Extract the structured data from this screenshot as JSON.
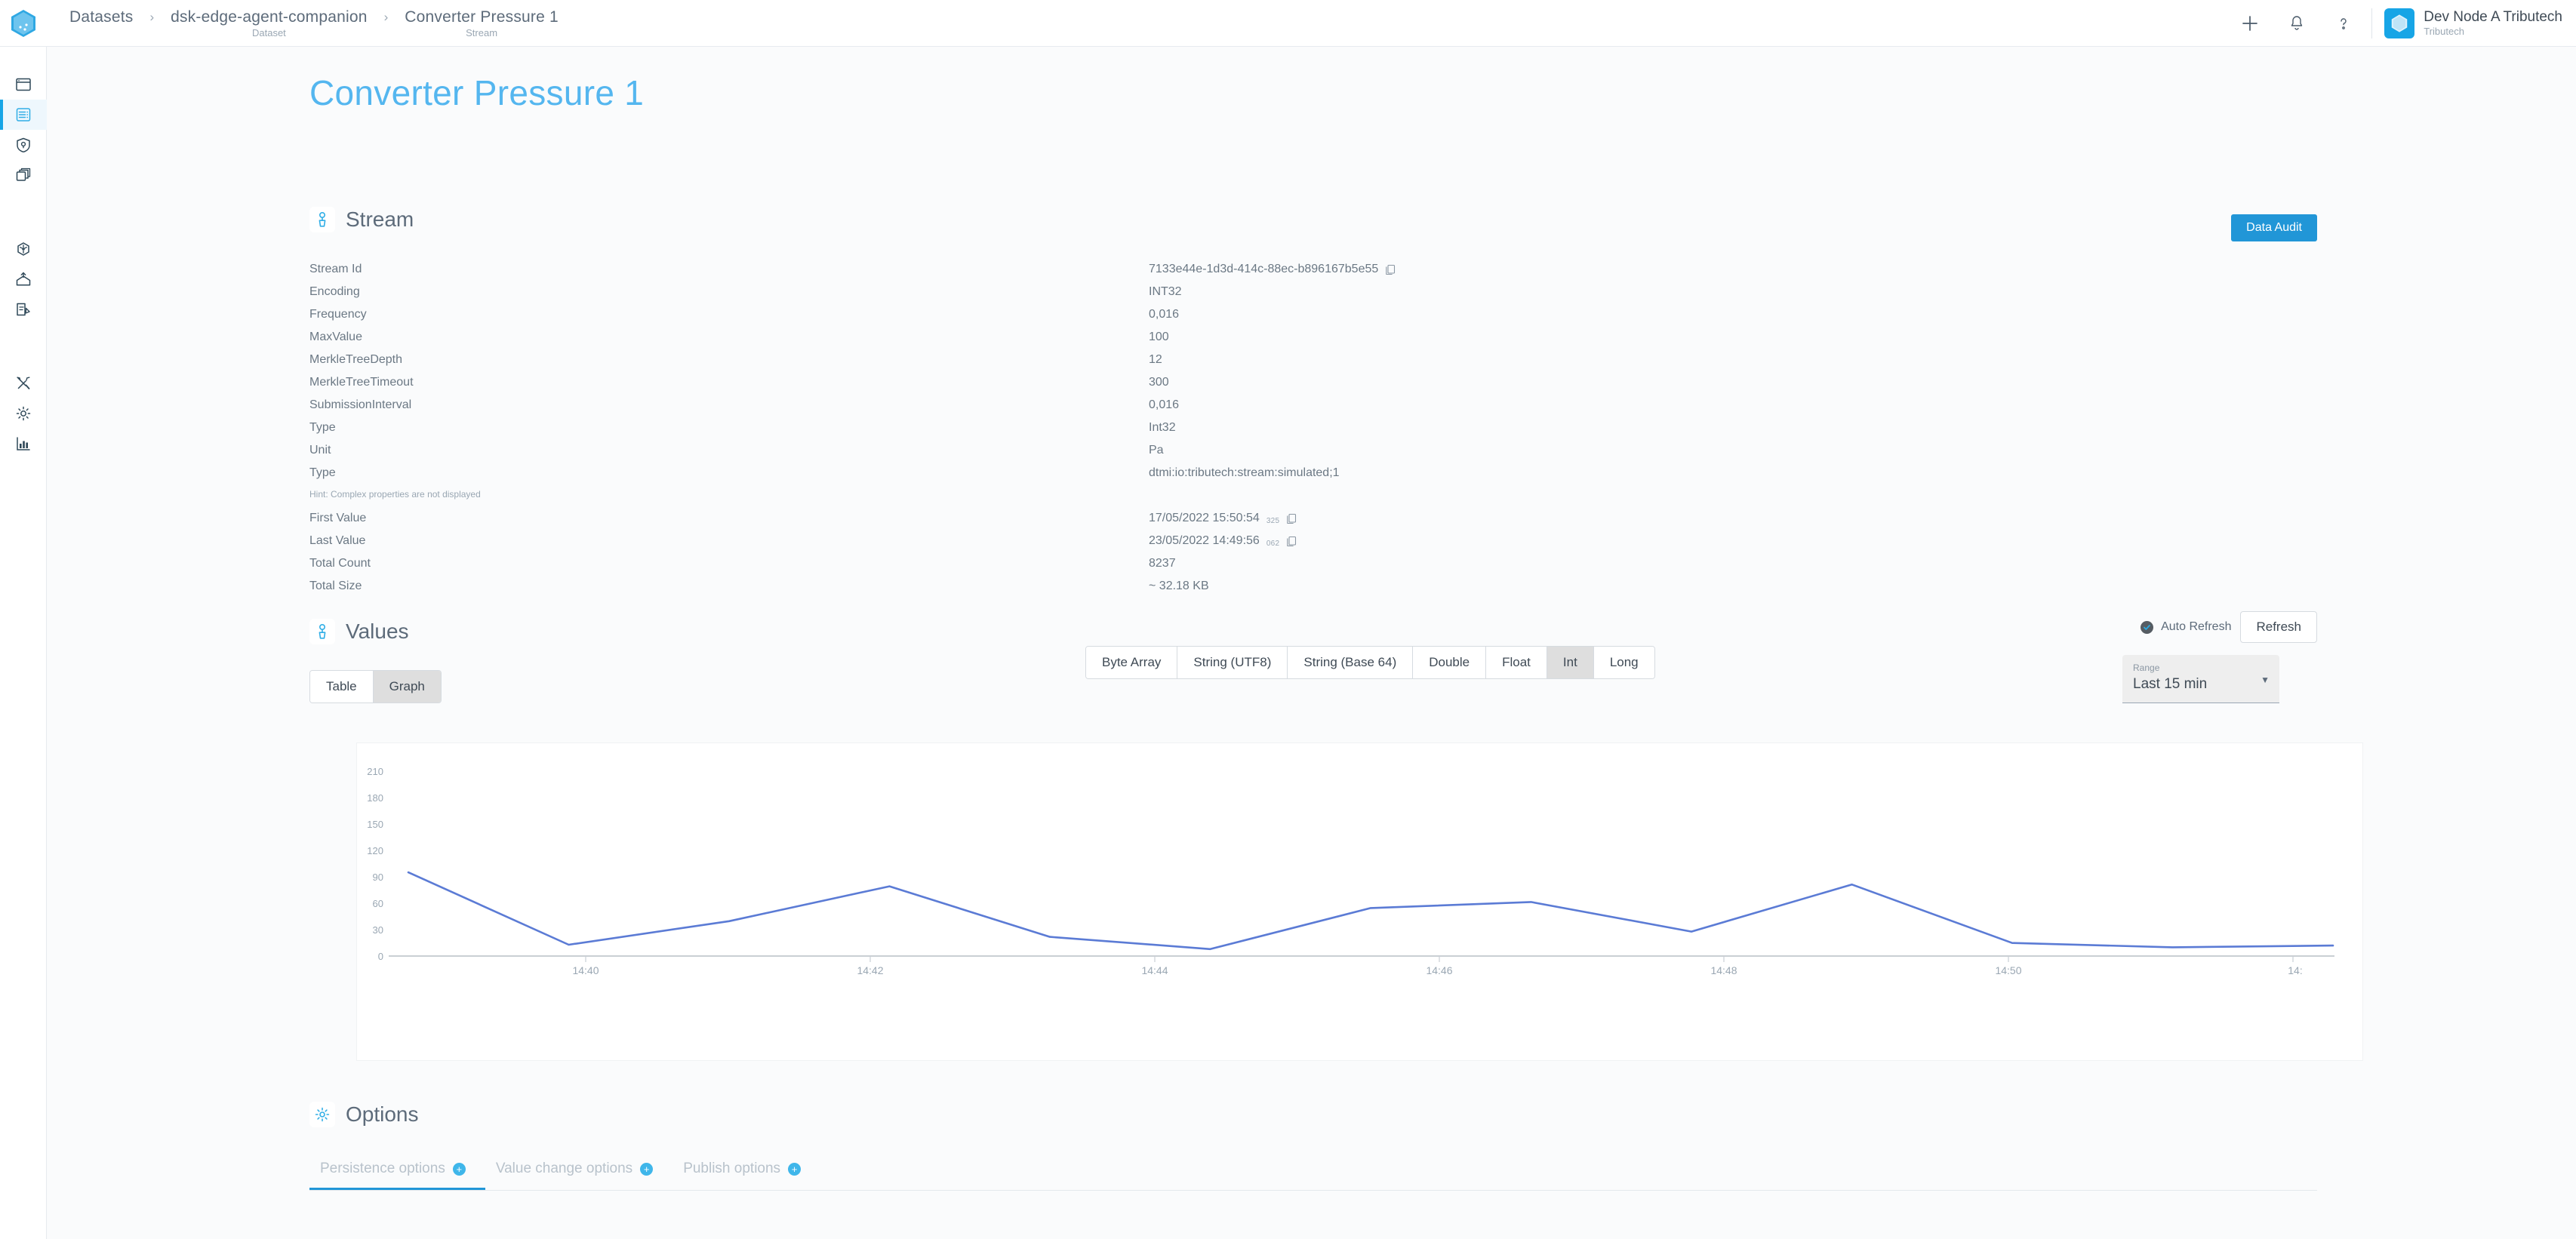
{
  "topbar": {
    "logo_icon": "tributech-hex-logo",
    "breadcrumb": [
      {
        "label": "Datasets",
        "sub": ""
      },
      {
        "label": "dsk-edge-agent-companion",
        "sub": "Dataset"
      },
      {
        "label": "Converter Pressure 1",
        "sub": "Stream"
      }
    ],
    "separator": "›",
    "actions": [
      {
        "name": "add-icon",
        "glyph": "+"
      },
      {
        "name": "notifications-bell-icon",
        "glyph": "bell"
      },
      {
        "name": "help-icon",
        "glyph": "?"
      }
    ],
    "account": {
      "name": "Dev Node A Tributech",
      "org": "Tributech"
    }
  },
  "sidebar": {
    "items": [
      {
        "name": "sidebar-item-overview",
        "icon": "window-icon",
        "active": false
      },
      {
        "name": "sidebar-item-datasets",
        "icon": "datasets-icon",
        "active": true
      },
      {
        "name": "sidebar-item-security",
        "icon": "shield-lock-icon",
        "active": false
      },
      {
        "name": "sidebar-item-twins",
        "icon": "layers-icon",
        "active": false
      },
      {
        "name": "sidebar-item-network",
        "icon": "network-node-icon",
        "active": false
      },
      {
        "name": "sidebar-item-inbox",
        "icon": "inbox-upload-icon",
        "active": false
      },
      {
        "name": "sidebar-item-requests",
        "icon": "edit-document-icon",
        "active": false
      },
      {
        "name": "sidebar-item-tools",
        "icon": "tools-icon",
        "active": false
      },
      {
        "name": "sidebar-item-settings",
        "icon": "gear-icon",
        "active": false
      },
      {
        "name": "sidebar-item-analytics",
        "icon": "bar-chart-icon",
        "active": false
      }
    ]
  },
  "page": {
    "title": "Converter Pressure 1"
  },
  "stream": {
    "section_title": "Stream",
    "section_icon": "stream-icon",
    "data_audit_label": "Data Audit",
    "properties": [
      {
        "key": "Stream Id",
        "value": "7133e44e-1d3d-414c-88ec-b896167b5e55",
        "copy": true
      },
      {
        "key": "Encoding",
        "value": "INT32",
        "copy": false
      },
      {
        "key": "Frequency",
        "value": "0,016",
        "copy": false
      },
      {
        "key": "MaxValue",
        "value": "100",
        "copy": false
      },
      {
        "key": "MerkleTreeDepth",
        "value": "12",
        "copy": false
      },
      {
        "key": "MerkleTreeTimeout",
        "value": "300",
        "copy": false
      },
      {
        "key": "SubmissionInterval",
        "value": "0,016",
        "copy": false
      },
      {
        "key": "Type",
        "value": "Int32",
        "copy": false
      },
      {
        "key": "Unit",
        "value": "Pa",
        "copy": false
      },
      {
        "key": "Type",
        "value": "dtmi:io:tributech:stream:simulated;1",
        "copy": false
      }
    ],
    "hint": "Hint: Complex properties are not displayed",
    "stats": [
      {
        "key": "First Value",
        "value": "17/05/2022 15:50:54",
        "ms": "325",
        "copy": true
      },
      {
        "key": "Last Value",
        "value": "23/05/2022 14:49:56",
        "ms": "062",
        "copy": true
      },
      {
        "key": "Total Count",
        "value": "8237",
        "ms": "",
        "copy": false
      },
      {
        "key": "Total Size",
        "value": "~ 32.18 KB",
        "ms": "",
        "copy": false
      }
    ]
  },
  "values": {
    "section_title": "Values",
    "section_icon": "stream-icon",
    "view_modes": [
      {
        "label": "Table",
        "active": false
      },
      {
        "label": "Graph",
        "active": true
      }
    ],
    "type_buttons": [
      {
        "label": "Byte Array",
        "active": false
      },
      {
        "label": "String (UTF8)",
        "active": false
      },
      {
        "label": "String (Base 64)",
        "active": false
      },
      {
        "label": "Double",
        "active": false
      },
      {
        "label": "Float",
        "active": false
      },
      {
        "label": "Int",
        "active": true
      },
      {
        "label": "Long",
        "active": false
      }
    ],
    "auto_refresh_label": "Auto Refresh",
    "auto_refresh_on": true,
    "refresh_label": "Refresh",
    "range_label": "Range",
    "range_value": "Last 15 min"
  },
  "chart_data": {
    "type": "line",
    "title": "",
    "xlabel": "",
    "ylabel": "",
    "ylim": [
      0,
      225
    ],
    "yticks": [
      0,
      30,
      60,
      90,
      120,
      150,
      180,
      210
    ],
    "xticks": [
      "14:40",
      "14:42",
      "14:44",
      "14:46",
      "14:48",
      "14:50",
      "14:"
    ],
    "grid": false,
    "legend": "none",
    "line_color": "#5b7bd5",
    "series": [
      {
        "name": "Converter Pressure 1",
        "x": [
          "14:39",
          "14:40:30",
          "14:42:45",
          "14:44:10",
          "14:45:10",
          "14:46:15",
          "14:47:00",
          "14:47:45",
          "14:48:45",
          "14:50:00",
          "14:51:00",
          "14:52:00"
        ],
        "values": [
          96,
          13,
          40,
          80,
          22,
          8,
          55,
          62,
          28,
          82,
          15,
          10,
          12
        ]
      }
    ]
  },
  "options": {
    "section_title": "Options",
    "section_icon": "gear-icon",
    "tabs": [
      {
        "label": "Persistence options",
        "active": true
      },
      {
        "label": "Value change options",
        "active": false
      },
      {
        "label": "Publish options",
        "active": false
      }
    ],
    "info_glyph": "⬤"
  },
  "colors": {
    "accent": "#2196d7",
    "title": "#54b6ef",
    "line": "#5b7bd5",
    "sidebar_active": "#eef7fd"
  }
}
